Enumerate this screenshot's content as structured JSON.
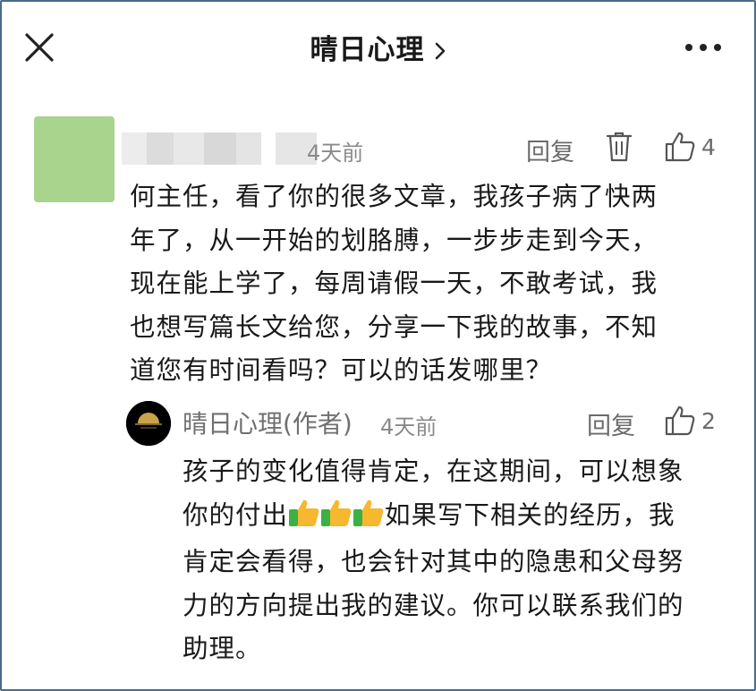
{
  "header": {
    "title": "晴日心理",
    "close_icon": "close-icon",
    "chevron_icon": "chevron-right-icon",
    "more_icon": "more-horizontal-icon"
  },
  "comment": {
    "time": "4天前",
    "reply_label": "回复",
    "like_count": "4",
    "lines": [
      "何主任，看了你的很多文章，我孩子病了快两",
      "年了，从一开始的划胳膊，一步步走到今天，",
      "现在能上学了，每周请假一天，不敢考试，我",
      "也想写篇长文给您，分享一下我的故事，不知",
      "道您有时间看吗？可以的话发哪里？"
    ]
  },
  "reply": {
    "author": "晴日心理(作者)",
    "time": "4天前",
    "reply_label": "回复",
    "like_count": "2",
    "line1": "孩子的变化值得肯定，在这期间，可以想象",
    "line2_prefix": "你的付出",
    "line2_suffix": "如果写下相关的经历，我",
    "line3": "肯定会看得，也会针对其中的隐患和父母努",
    "line4": "力的方向提出我的建议。你可以联系我们的",
    "line5": "助理。"
  },
  "colors": {
    "avatar_green": "#a8d48e",
    "meta_gray": "#8a8a8a",
    "emoji_yellow": "#f5b82e",
    "emoji_green": "#3cb043"
  }
}
